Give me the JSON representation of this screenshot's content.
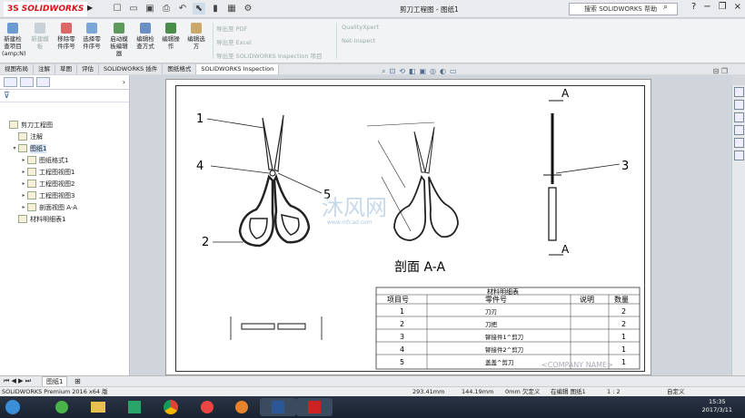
{
  "app": {
    "brand": "SOLIDWORKS",
    "doc_title": "剪刀工程图 - 图纸1",
    "help_placeholder": "搜索 SOLIDWORKS 帮助"
  },
  "ribbon": {
    "buttons": [
      {
        "label": "新建检查项目 (amp;N)",
        "enabled": true
      },
      {
        "label": "新建模板",
        "enabled": false
      },
      {
        "label": "移除零件序号",
        "enabled": true
      },
      {
        "label": "选择零件序号",
        "enabled": true
      },
      {
        "label": "启动模板编辑器",
        "enabled": true
      },
      {
        "label": "编辑检查方式",
        "enabled": true
      },
      {
        "label": "编辑操作",
        "enabled": true
      },
      {
        "label": "编辑选方",
        "enabled": true
      }
    ],
    "export": [
      "导出至 PDF",
      "导出至 Excel",
      "导出至 SOLIDWORKS Inspection 项目"
    ],
    "extra": [
      "QualityXpert",
      "Net-Inspect"
    ]
  },
  "tabs": [
    "视图布局",
    "注解",
    "草图",
    "评估",
    "SOLIDWORKS 插件",
    "图纸格式",
    "SOLIDWORKS Inspection"
  ],
  "tree": [
    {
      "label": "剪刀工程图",
      "level": 0,
      "exp": ""
    },
    {
      "label": "注解",
      "level": 1,
      "exp": ""
    },
    {
      "label": "图纸1",
      "level": 1,
      "exp": "▾",
      "selected": true
    },
    {
      "label": "图纸格式1",
      "level": 2,
      "exp": "▸"
    },
    {
      "label": "工程图视图1",
      "level": 2,
      "exp": "▸"
    },
    {
      "label": "工程图视图2",
      "level": 2,
      "exp": "▸"
    },
    {
      "label": "工程图视图3",
      "level": 2,
      "exp": "▸"
    },
    {
      "label": "剖面视图 A-A",
      "level": 2,
      "exp": "▸"
    },
    {
      "label": "材料明细表1",
      "level": 1,
      "exp": ""
    }
  ],
  "drawing": {
    "balloons": [
      "1",
      "2",
      "3",
      "4",
      "5"
    ],
    "section_label": "剖面 A-A",
    "section_letter": "A",
    "bom": {
      "title": "材料明细表",
      "headers": [
        "项目号",
        "零件号",
        "说明",
        "数量"
      ],
      "rows": [
        [
          "1",
          "刀刃",
          "",
          "2"
        ],
        [
          "2",
          "刀把",
          "",
          "2"
        ],
        [
          "3",
          "铆接件1^剪刀",
          "",
          "1"
        ],
        [
          "4",
          "铆接件2^剪刀",
          "",
          "1"
        ],
        [
          "5",
          "盖盖^剪刀",
          "",
          "1"
        ]
      ]
    },
    "company": "<COMPANY NAME>",
    "watermark": "沐风网",
    "watermark_url": "www.mfcad.com"
  },
  "sheet_tab": "图纸1",
  "status": {
    "product": "SOLIDWORKS Premium 2016 x64 版",
    "x": "293.41mm",
    "y": "144.19mm",
    "z": "0mm 欠定义",
    "mode": "在编辑 图纸1",
    "scale": "1 : 2",
    "units": "自定义"
  },
  "taskbar": {
    "time": "15:35",
    "date": "2017/3/11"
  }
}
